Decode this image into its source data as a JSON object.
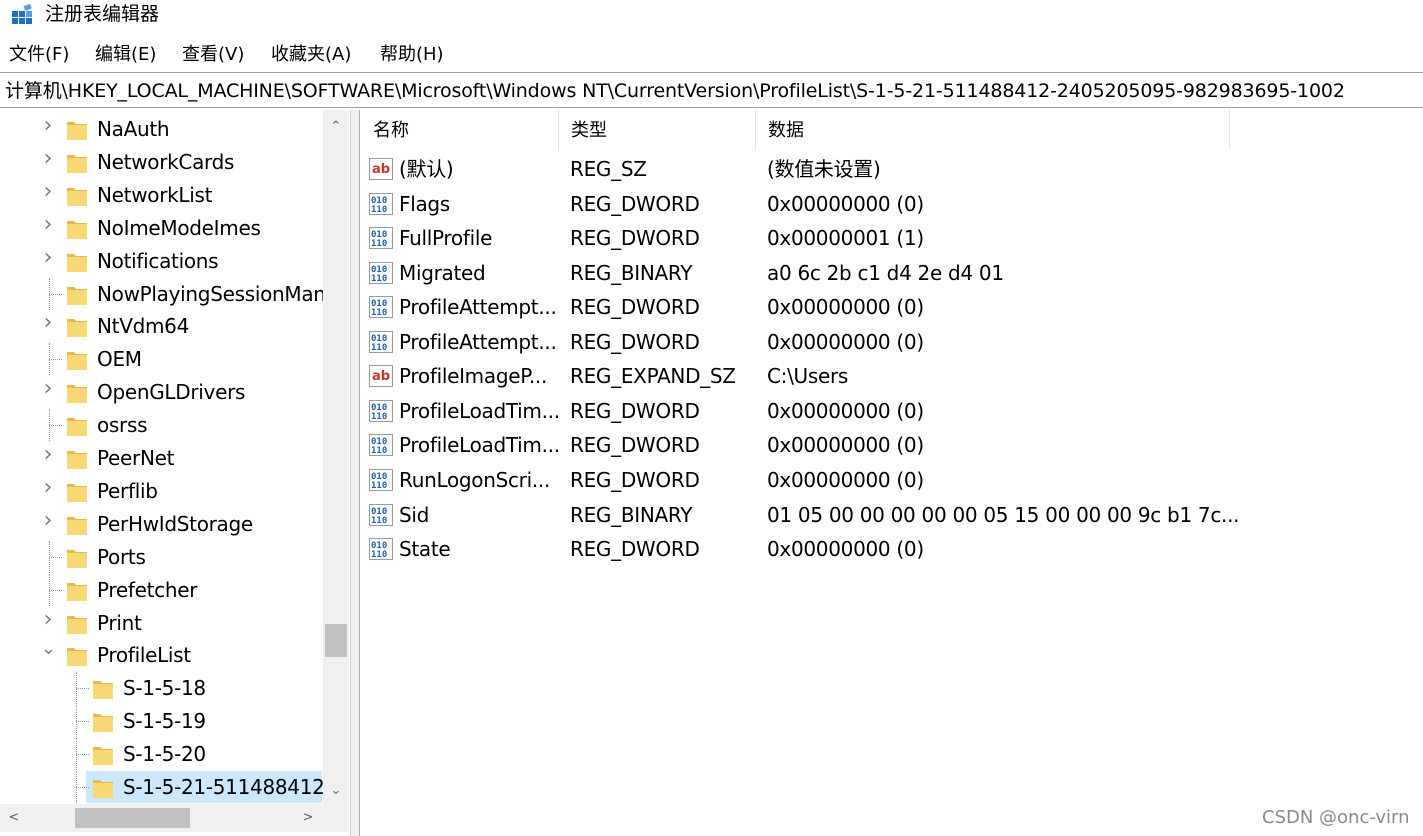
{
  "window": {
    "title": "注册表编辑器",
    "icon": "registry-editor-icon"
  },
  "menu": [
    {
      "label": "文件(F)"
    },
    {
      "label": "编辑(E)"
    },
    {
      "label": "查看(V)"
    },
    {
      "label": "收藏夹(A)"
    },
    {
      "label": "帮助(H)"
    }
  ],
  "address": {
    "path": "计算机\\HKEY_LOCAL_MACHINE\\SOFTWARE\\Microsoft\\Windows NT\\CurrentVersion\\ProfileList\\S-1-5-21-511488412-2405205095-982983695-1002"
  },
  "tree": {
    "nodes": [
      {
        "label": "NaAuth",
        "expander": "collapsed"
      },
      {
        "label": "NetworkCards",
        "expander": "collapsed"
      },
      {
        "label": "NetworkList",
        "expander": "collapsed"
      },
      {
        "label": "NoImeModeImes",
        "expander": "collapsed"
      },
      {
        "label": "Notifications",
        "expander": "collapsed"
      },
      {
        "label": "NowPlayingSessionMan",
        "expander": "none"
      },
      {
        "label": "NtVdm64",
        "expander": "collapsed"
      },
      {
        "label": "OEM",
        "expander": "none"
      },
      {
        "label": "OpenGLDrivers",
        "expander": "collapsed"
      },
      {
        "label": "osrss",
        "expander": "none"
      },
      {
        "label": "PeerNet",
        "expander": "collapsed"
      },
      {
        "label": "Perflib",
        "expander": "collapsed"
      },
      {
        "label": "PerHwIdStorage",
        "expander": "collapsed"
      },
      {
        "label": "Ports",
        "expander": "none"
      },
      {
        "label": "Prefetcher",
        "expander": "none"
      },
      {
        "label": "Print",
        "expander": "collapsed"
      },
      {
        "label": "ProfileList",
        "expander": "expanded"
      },
      {
        "label": "S-1-5-18",
        "expander": "child"
      },
      {
        "label": "S-1-5-19",
        "expander": "child"
      },
      {
        "label": "S-1-5-20",
        "expander": "child"
      },
      {
        "label": "S-1-5-21-511488412-",
        "expander": "child",
        "selected": true
      }
    ]
  },
  "list": {
    "columns": [
      "名称",
      "类型",
      "数据"
    ],
    "rows": [
      {
        "icon": "string-value-icon",
        "name": "(默认)",
        "type": "REG_SZ",
        "data": "(数值未设置)"
      },
      {
        "icon": "binary-value-icon",
        "name": "Flags",
        "type": "REG_DWORD",
        "data": "0x00000000 (0)"
      },
      {
        "icon": "binary-value-icon",
        "name": "FullProfile",
        "type": "REG_DWORD",
        "data": "0x00000001 (1)"
      },
      {
        "icon": "binary-value-icon",
        "name": "Migrated",
        "type": "REG_BINARY",
        "data": "a0 6c 2b c1 d4 2e d4 01"
      },
      {
        "icon": "binary-value-icon",
        "name": "ProfileAttempt...",
        "type": "REG_DWORD",
        "data": "0x00000000 (0)"
      },
      {
        "icon": "binary-value-icon",
        "name": "ProfileAttempt...",
        "type": "REG_DWORD",
        "data": "0x00000000 (0)"
      },
      {
        "icon": "string-value-icon",
        "name": "ProfileImageP...",
        "type": "REG_EXPAND_SZ",
        "data": "C:\\Users"
      },
      {
        "icon": "binary-value-icon",
        "name": "ProfileLoadTim...",
        "type": "REG_DWORD",
        "data": "0x00000000 (0)"
      },
      {
        "icon": "binary-value-icon",
        "name": "ProfileLoadTim...",
        "type": "REG_DWORD",
        "data": "0x00000000 (0)"
      },
      {
        "icon": "binary-value-icon",
        "name": "RunLogonScri...",
        "type": "REG_DWORD",
        "data": "0x00000000 (0)"
      },
      {
        "icon": "binary-value-icon",
        "name": "Sid",
        "type": "REG_BINARY",
        "data": "01 05 00 00 00 00 00 05 15 00 00 00 9c b1 7c..."
      },
      {
        "icon": "binary-value-icon",
        "name": "State",
        "type": "REG_DWORD",
        "data": "0x00000000 (0)"
      }
    ]
  },
  "watermark": "CSDN @onc-virn",
  "colors": {
    "selection": "#cce8ff",
    "folder": "#f8d775",
    "folder_dark": "#e8b84a",
    "string_icon": "#c0392b",
    "binary_icon": "#1f5fb0"
  }
}
